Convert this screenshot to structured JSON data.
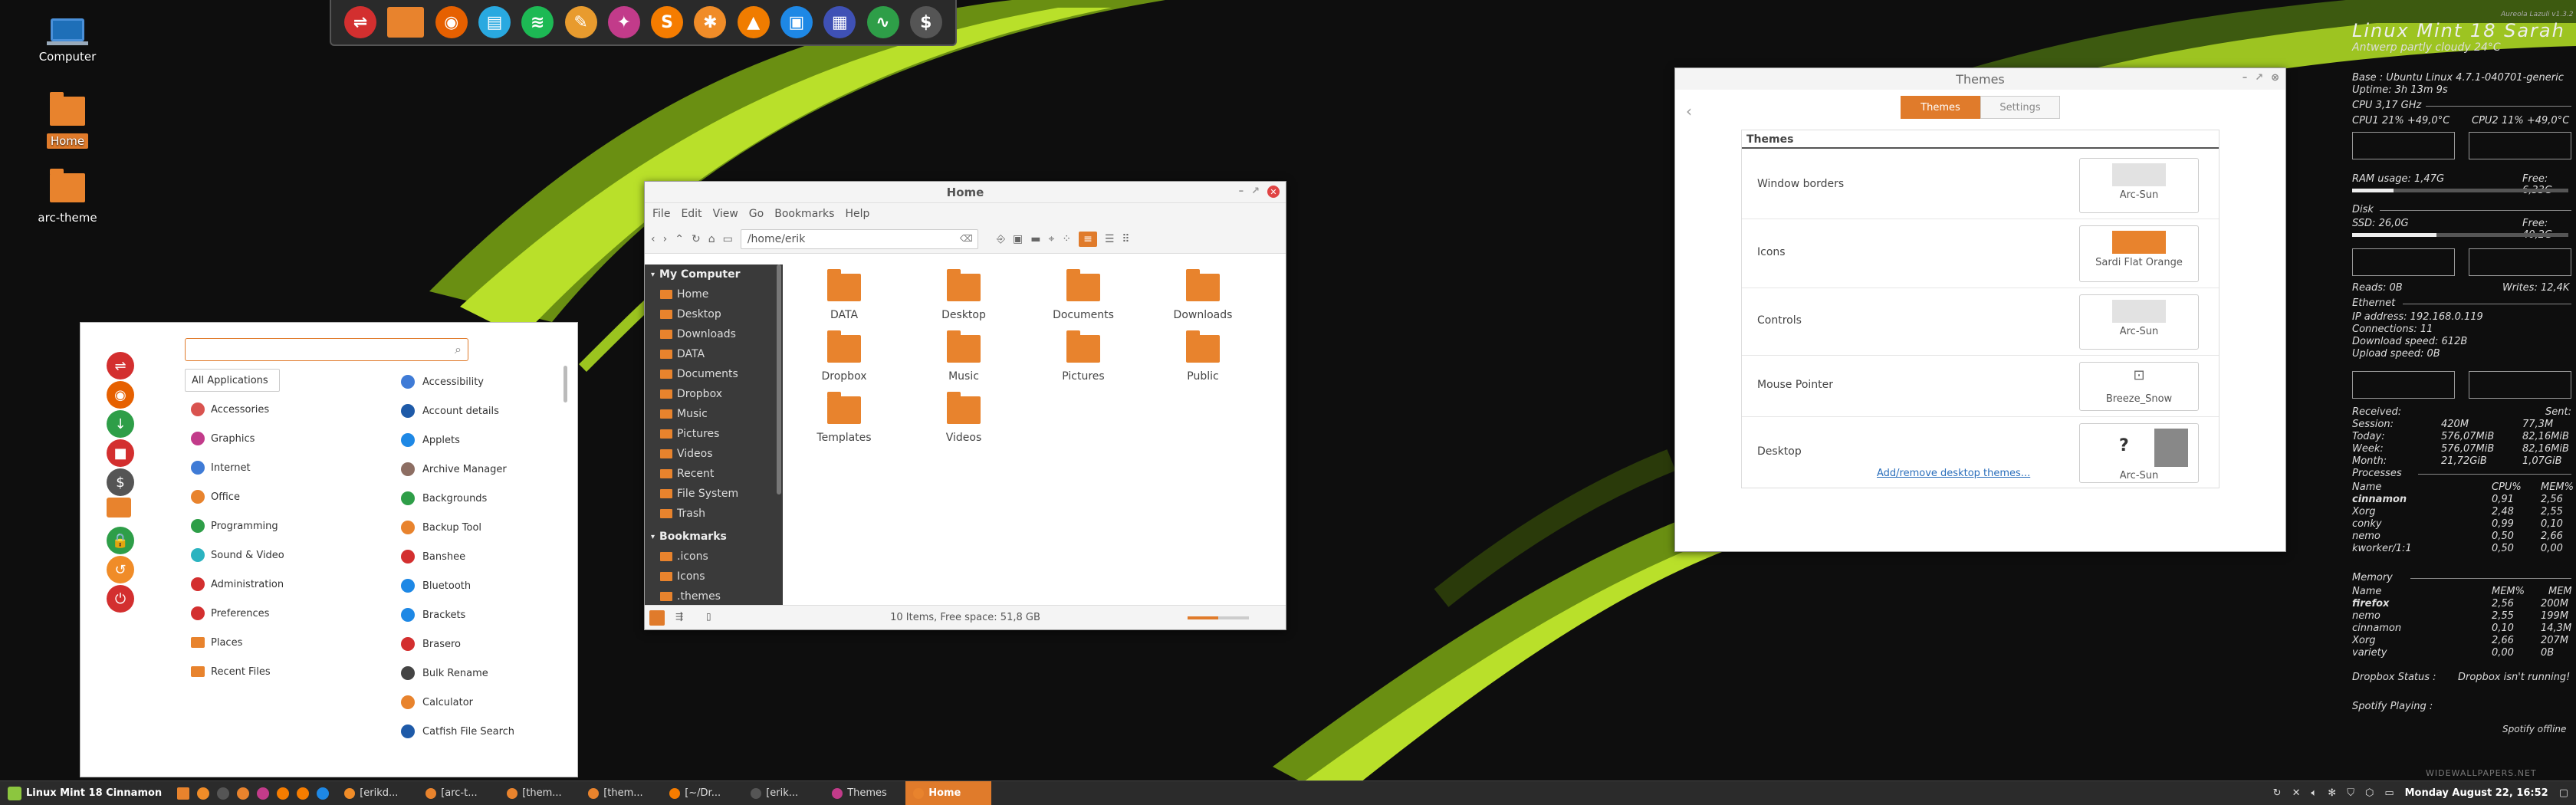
{
  "desktop": {
    "icons": [
      {
        "label": "Computer"
      },
      {
        "label": "Home"
      },
      {
        "label": "arc-theme"
      }
    ],
    "watermark": "WIDEWALLPAPERS.NET",
    "corner_text": "Aureola Lazuli v1.3.2"
  },
  "dock": {
    "icons": [
      {
        "name": "mintupdate-icon",
        "color": "#d32f2f",
        "glyph": "⇌"
      },
      {
        "name": "files-icon",
        "color": "#e8832d",
        "glyph": ""
      },
      {
        "name": "firefox-icon",
        "color": "#e66000",
        "glyph": "◉"
      },
      {
        "name": "text-editor-icon",
        "color": "#29a9e0",
        "glyph": "▤"
      },
      {
        "name": "spotify-icon",
        "color": "#1db954",
        "glyph": "≋"
      },
      {
        "name": "gimp-icon",
        "color": "#e89b2e",
        "glyph": "✎"
      },
      {
        "name": "inkscape-icon",
        "color": "#c23b8a",
        "glyph": "✦"
      },
      {
        "name": "sublime-icon",
        "color": "#f57c00",
        "glyph": "S"
      },
      {
        "name": "transmission-icon",
        "color": "#f08c28",
        "glyph": "✱"
      },
      {
        "name": "vlc-icon",
        "color": "#f07c00",
        "glyph": "▲"
      },
      {
        "name": "nemo-icon",
        "color": "#1e88e5",
        "glyph": "▣"
      },
      {
        "name": "virtualbox-icon",
        "color": "#3f51b5",
        "glyph": "▦"
      },
      {
        "name": "system-monitor-icon",
        "color": "#2e9e48",
        "glyph": "∿"
      },
      {
        "name": "terminal-icon",
        "color": "#555555",
        "glyph": "$"
      }
    ]
  },
  "menu": {
    "search_placeholder": "",
    "favorites": [
      {
        "name": "mintupdate-fav-icon",
        "color": "#d32f2f",
        "glyph": "⇌"
      },
      {
        "name": "firefox-fav-icon",
        "color": "#e66000",
        "glyph": "◉"
      },
      {
        "name": "download-fav-icon",
        "color": "#2e9e48",
        "glyph": "↓"
      },
      {
        "name": "media-fav-icon",
        "color": "#d32f2f",
        "glyph": "■"
      },
      {
        "name": "terminal-fav-icon",
        "color": "#555555",
        "glyph": "$"
      },
      {
        "name": "folder-fav-icon",
        "color": "#e8832d",
        "glyph": ""
      },
      {
        "name": "lock-fav-icon",
        "color": "#2e9e48",
        "glyph": "🔒"
      },
      {
        "name": "logout-fav-icon",
        "color": "#f08c28",
        "glyph": "↺"
      },
      {
        "name": "power-fav-icon",
        "color": "#d32f2f",
        "glyph": "⏻"
      }
    ],
    "categories": [
      {
        "label": "All Applications",
        "color": ""
      },
      {
        "label": "Accessories",
        "color": "#d9534f"
      },
      {
        "label": "Graphics",
        "color": "#c23b8a"
      },
      {
        "label": "Internet",
        "color": "#3f7bd6"
      },
      {
        "label": "Office",
        "color": "#e8832d"
      },
      {
        "label": "Programming",
        "color": "#2e9e48"
      },
      {
        "label": "Sound & Video",
        "color": "#2bb3c0"
      },
      {
        "label": "Administration",
        "color": "#d32f2f"
      },
      {
        "label": "Preferences",
        "color": "#d32f2f"
      },
      {
        "label": "Places",
        "color": "#e8832d"
      },
      {
        "label": "Recent Files",
        "color": "#e8832d"
      }
    ],
    "apps": [
      {
        "label": "Accessibility",
        "color": "#3f7bd6"
      },
      {
        "label": "Account details",
        "color": "#1e5aa8"
      },
      {
        "label": "Applets",
        "color": "#1e88e5"
      },
      {
        "label": "Archive Manager",
        "color": "#8d6e63"
      },
      {
        "label": "Backgrounds",
        "color": "#2e9e48"
      },
      {
        "label": "Backup Tool",
        "color": "#e8832d"
      },
      {
        "label": "Banshee",
        "color": "#d32f2f"
      },
      {
        "label": "Bluetooth",
        "color": "#1e88e5"
      },
      {
        "label": "Brackets",
        "color": "#1e88e5"
      },
      {
        "label": "Brasero",
        "color": "#d32f2f"
      },
      {
        "label": "Bulk Rename",
        "color": "#444444"
      },
      {
        "label": "Calculator",
        "color": "#e8832d"
      },
      {
        "label": "Catfish File Search",
        "color": "#1e5aa8"
      }
    ]
  },
  "filemanager": {
    "title": "Home",
    "menubar": [
      "File",
      "Edit",
      "View",
      "Go",
      "Bookmarks",
      "Help"
    ],
    "path": "/home/erik",
    "sidebar": {
      "sections": [
        {
          "header": "My Computer",
          "items": [
            "Home",
            "Desktop",
            "Downloads",
            "DATA",
            "Documents",
            "Dropbox",
            "Music",
            "Pictures",
            "Videos",
            "Recent",
            "File System",
            "Trash"
          ]
        },
        {
          "header": "Bookmarks",
          "items": [
            ".icons",
            "Icons",
            ".themes"
          ]
        }
      ]
    },
    "files": [
      "DATA",
      "Desktop",
      "Documents",
      "Downloads",
      "Dropbox",
      "Music",
      "Pictures",
      "Public",
      "Templates",
      "Videos"
    ],
    "status": "10 Items, Free space: 51,8 GB"
  },
  "themes": {
    "title": "Themes",
    "tabs": [
      "Themes",
      "Settings"
    ],
    "panel_title": "Themes",
    "rows": [
      {
        "label": "Window borders",
        "value": "Arc-Sun"
      },
      {
        "label": "Icons",
        "value": "Sardi Flat Orange"
      },
      {
        "label": "Controls",
        "value": "Arc-Sun"
      },
      {
        "label": "Mouse Pointer",
        "value": "Breeze_Snow"
      },
      {
        "label": "Desktop",
        "value": "Arc-Sun"
      }
    ],
    "desktop_preview_mark": "?",
    "link": "Add/remove desktop themes..."
  },
  "conky": {
    "title": "Linux Mint 18 Sarah",
    "weather": "Antwerp partly cloudy 24°C",
    "base": "Base : Ubuntu Linux 4.7.1-040701-generic",
    "uptime": "Uptime: 3h 13m 9s",
    "cpu": "CPU 3,17 GHz",
    "cpu1": "CPU1 21% +49,0°C",
    "cpu2": "CPU2 11% +49,0°C",
    "ram_label": "RAM usage: 1,47G",
    "ram_free": "Free: 6,33G",
    "ram_fraction": 0.19,
    "disk": "Disk",
    "ssd_label": "SSD: 26,0G",
    "ssd_free": "Free: 40,2G",
    "ssd_fraction": 0.39,
    "reads": "Reads: 0B",
    "writes": "Writes: 12,4K",
    "ethernet": "Ethernet",
    "ip": "IP address: 192.168.0.119",
    "connections": "Connections: 11",
    "download": "Download speed: 612B",
    "upload": "Upload speed: 0B",
    "traffic": [
      {
        "label": "Received:",
        "value": "Sent:"
      },
      {
        "label": "Session:",
        "rx": "420M",
        "tx": "77,3M"
      },
      {
        "label": "Today:",
        "rx": "576,07MiB",
        "tx": "82,16MiB"
      },
      {
        "label": "Week:",
        "rx": "576,07MiB",
        "tx": "82,16MiB"
      },
      {
        "label": "Month:",
        "rx": "21,72GiB",
        "tx": "1,07GiB"
      }
    ],
    "processes_header": "Processes",
    "processes_cols": [
      "Name",
      "CPU%",
      "MEM%"
    ],
    "processes": [
      {
        "name": "cinnamon",
        "a": "0,91",
        "b": "2,56"
      },
      {
        "name": "Xorg",
        "a": "2,48",
        "b": "2,55"
      },
      {
        "name": "conky",
        "a": "0,99",
        "b": "0,10"
      },
      {
        "name": "nemo",
        "a": "0,50",
        "b": "2,66"
      },
      {
        "name": "kworker/1:1",
        "a": "0,50",
        "b": "0,00"
      }
    ],
    "memory_header": "Memory",
    "memory_cols": [
      "Name",
      "MEM%",
      "MEM"
    ],
    "memory": [
      {
        "name": "firefox",
        "a": "2,56",
        "b": "200M"
      },
      {
        "name": "nemo",
        "a": "2,55",
        "b": "199M"
      },
      {
        "name": "cinnamon",
        "a": "0,10",
        "b": "14,3M"
      },
      {
        "name": "Xorg",
        "a": "2,66",
        "b": "207M"
      },
      {
        "name": "variety",
        "a": "0,00",
        "b": "0B"
      }
    ],
    "dropbox_label": "Dropbox Status :",
    "dropbox_value": "Dropbox isn't running!",
    "spotify_label": "Spotify Playing :",
    "spotify_value": "Spotify offline"
  },
  "taskbar": {
    "start_label": "Linux Mint 18 Cinnamon",
    "windows": [
      {
        "label": "[erikd...",
        "color": "#f08c28"
      },
      {
        "label": "[arc-t...",
        "color": "#e8832d"
      },
      {
        "label": "[them...",
        "color": "#e8832d"
      },
      {
        "label": "[them...",
        "color": "#e8832d"
      },
      {
        "label": "[~/Dr...",
        "color": "#f57c00"
      },
      {
        "label": "[erik...",
        "color": "#555555"
      },
      {
        "label": "Themes",
        "color": "#c23b8a"
      },
      {
        "label": "Home",
        "color": "#e8832d"
      }
    ],
    "clock": "Monday August 22, 16:52"
  }
}
